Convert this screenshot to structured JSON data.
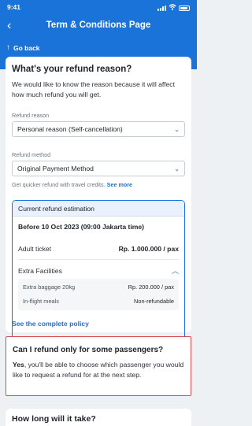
{
  "status_bar": {
    "time": "9:41"
  },
  "nav": {
    "title": "Term & Conditions Page",
    "go_back": "Go back"
  },
  "refund_reason": {
    "heading": "What's your refund reason?",
    "description": "We would like to know the reason because it will affect how much refund you will get.",
    "reason_label": "Refund reason",
    "reason_value": "Personal reason (Self-cancellation)",
    "method_label": "Refund method",
    "method_value": "Original Payment Method",
    "hint_text": "Get quicker refund with travel credits.",
    "hint_link": "See more"
  },
  "estimation": {
    "title": "Current refund estimation",
    "deadline": "Before 10 Oct 2023 (09:00 Jakarta time)",
    "adult_label": "Adult ticket",
    "adult_price": "Rp. 1.000.000 / pax",
    "extra_label": "Extra Facilities",
    "extras": [
      {
        "name": "Extra baggage 20kg",
        "value": "Rp. 200.000 / pax"
      },
      {
        "name": "In-flight meals",
        "value": "Non-refundable"
      }
    ]
  },
  "policy_link": "See the complete policy",
  "faq": {
    "question": "Can I refund only for some passengers?",
    "answer_bold": "Yes",
    "answer_rest": ", you'll be able to choose which passenger you would like to request a refund for at the next step."
  },
  "how_long": {
    "title": "How long will it take?"
  },
  "colors": {
    "primary": "#1a73d9",
    "highlight_border": "#d94b52",
    "background": "#eef1f4"
  },
  "icons": [
    "chevron-left-icon",
    "arrow-up-icon",
    "chevron-down-icon",
    "chevron-up-icon",
    "signal-icon",
    "wifi-icon",
    "battery-icon"
  ]
}
